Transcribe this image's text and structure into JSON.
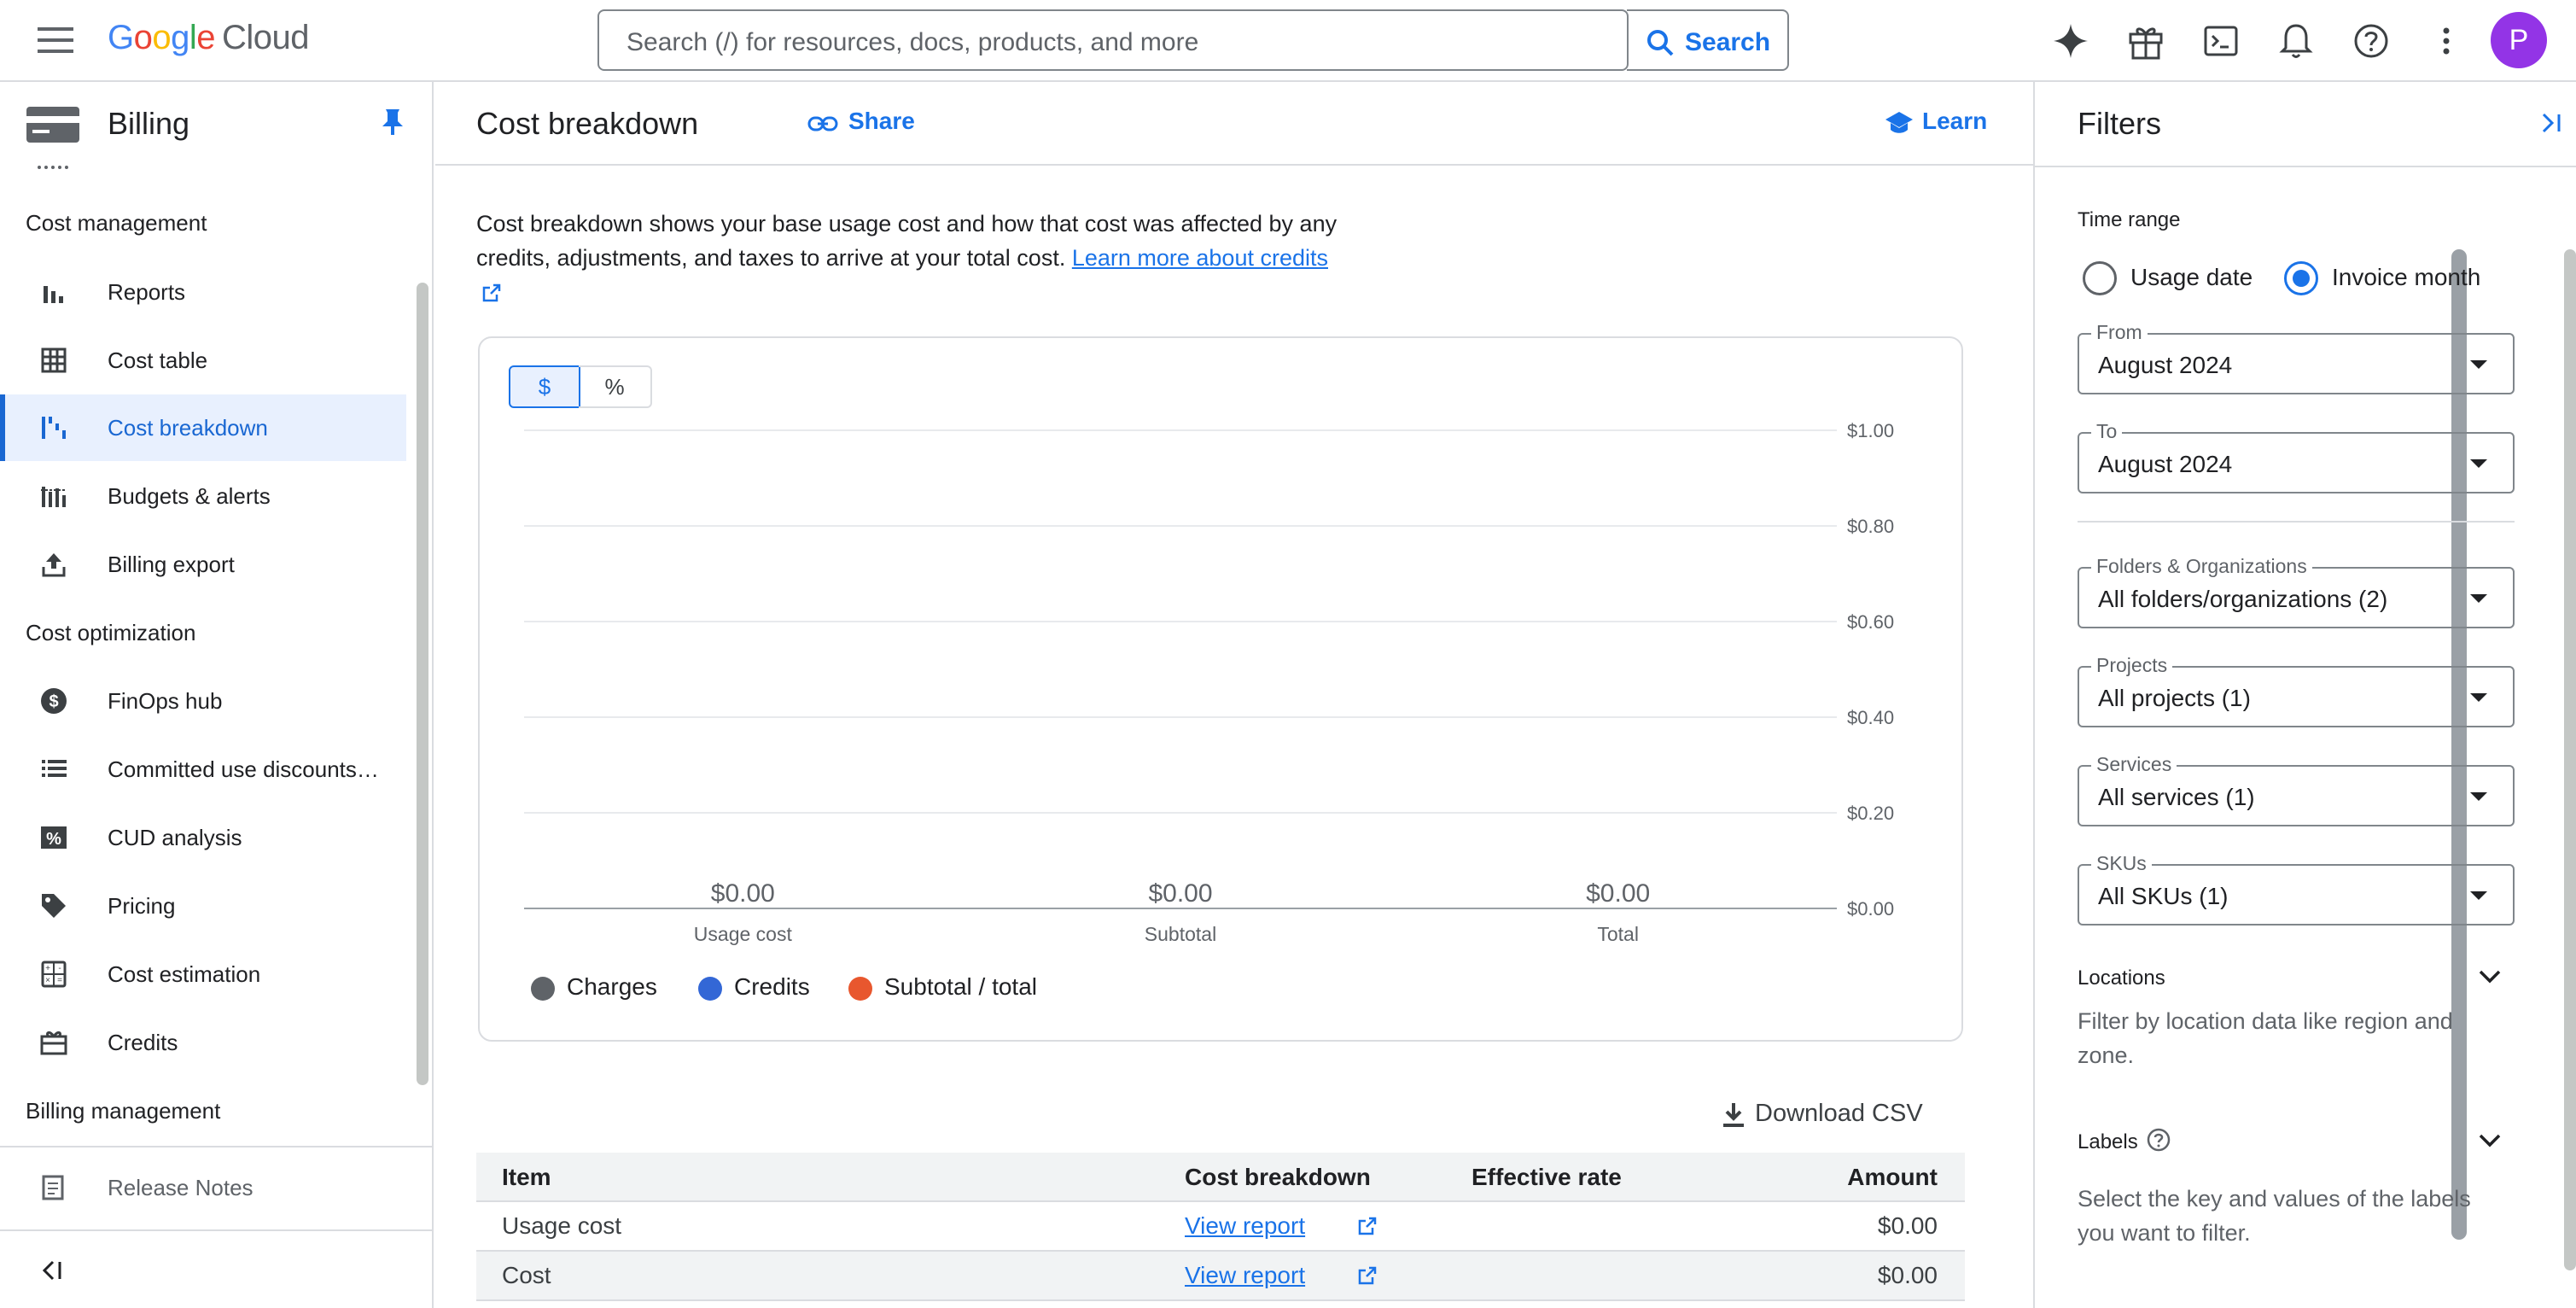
{
  "topbar": {
    "logo_google": [
      "G",
      "o",
      "o",
      "g",
      "l",
      "e"
    ],
    "logo_cloud": "Cloud",
    "search_placeholder": "Search (/) for resources, docs, products, and more",
    "search_button": "Search",
    "avatar_letter": "P"
  },
  "sidebar": {
    "title": "Billing",
    "sections": [
      "Cost management",
      "Cost optimization",
      "Billing management"
    ],
    "items": [
      {
        "label": "Reports",
        "icon": "bar-chart-icon"
      },
      {
        "label": "Cost table",
        "icon": "table-icon"
      },
      {
        "label": "Cost breakdown",
        "icon": "waterfall-icon",
        "active": true
      },
      {
        "label": "Budgets & alerts",
        "icon": "budget-icon"
      },
      {
        "label": "Billing export",
        "icon": "upload-icon"
      },
      {
        "label": "FinOps hub",
        "icon": "dollar-circle-icon"
      },
      {
        "label": "Committed use discounts…",
        "icon": "list-icon"
      },
      {
        "label": "CUD analysis",
        "icon": "percent-icon"
      },
      {
        "label": "Pricing",
        "icon": "tag-icon"
      },
      {
        "label": "Cost estimation",
        "icon": "calculator-icon"
      },
      {
        "label": "Credits",
        "icon": "gift-card-icon"
      }
    ],
    "release_notes": "Release Notes"
  },
  "main": {
    "title": "Cost breakdown",
    "share": "Share",
    "learn": "Learn",
    "description": "Cost breakdown shows your base usage cost and how that cost was affected by any credits, adjustments, and taxes to arrive at your total cost. ",
    "description_link": "Learn more about credits",
    "toggle_dollar": "$",
    "toggle_percent": "%",
    "legend": [
      {
        "label": "Charges",
        "color": "#5f6368"
      },
      {
        "label": "Credits",
        "color": "#3367d6"
      },
      {
        "label": "Subtotal / total",
        "color": "#e8572e"
      }
    ],
    "download_csv": "Download CSV",
    "table": {
      "headers": [
        "Item",
        "Cost breakdown",
        "Effective rate",
        "Amount"
      ],
      "rows": [
        {
          "item": "Usage cost",
          "link": "View report",
          "amount": "$0.00"
        },
        {
          "item": "Cost",
          "link": "View report",
          "amount": "$0.00"
        }
      ]
    }
  },
  "chart_data": {
    "type": "bar",
    "categories": [
      "Usage cost",
      "Subtotal",
      "Total"
    ],
    "values": [
      0,
      0,
      0
    ],
    "data_labels": [
      "$0.00",
      "$0.00",
      "$0.00"
    ],
    "y_ticks": [
      "$1.00",
      "$0.80",
      "$0.60",
      "$0.40",
      "$0.20",
      "$0.00"
    ],
    "ylim": [
      0,
      1
    ],
    "grid": true,
    "legend_placement": "bottom-left"
  },
  "filters": {
    "title": "Filters",
    "time_range_label": "Time range",
    "radio_usage": "Usage date",
    "radio_invoice": "Invoice month",
    "selected_radio": "Invoice month",
    "from_label": "From",
    "from_value": "August 2024",
    "to_label": "To",
    "to_value": "August 2024",
    "folders_label": "Folders & Organizations",
    "folders_value": "All folders/organizations (2)",
    "projects_label": "Projects",
    "projects_value": "All projects (1)",
    "services_label": "Services",
    "services_value": "All services (1)",
    "skus_label": "SKUs",
    "skus_value": "All SKUs (1)",
    "locations_label": "Locations",
    "locations_desc": "Filter by location data like region and zone.",
    "labels_label": "Labels",
    "labels_desc": "Select the key and values of the labels you want to filter."
  }
}
